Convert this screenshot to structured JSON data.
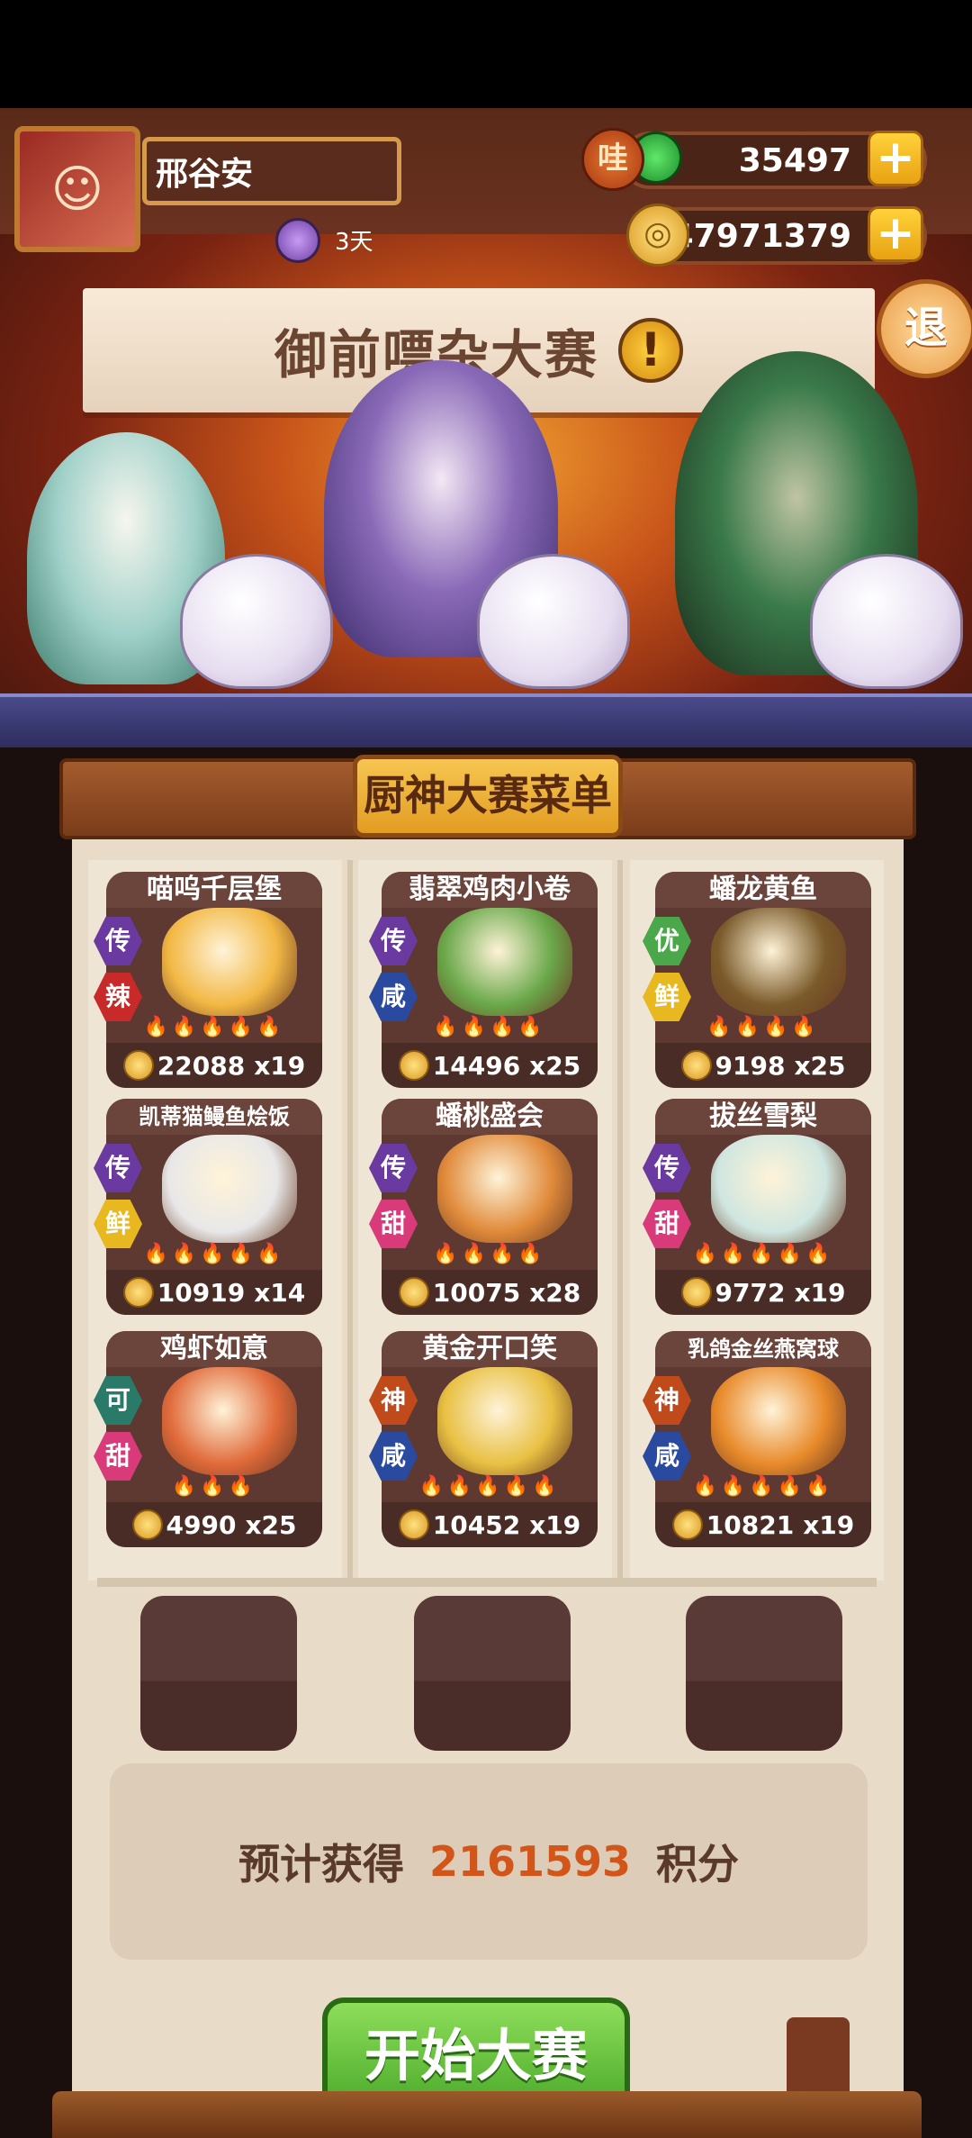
{
  "player": {
    "name": "邢谷安",
    "days": "3天"
  },
  "currencies": {
    "gem_label": "哇",
    "gems": "35497",
    "coins": "47971379",
    "plus": "+"
  },
  "exit_label": "退",
  "event_title": "御前嘌杂大赛",
  "alert_symbol": "!",
  "menu_title": "厨神大赛菜单",
  "dishes": [
    {
      "name": "喵呜千层堡",
      "rarity": "传",
      "flavor": "辣",
      "points": "22088",
      "count": "x19",
      "flames": "🔥🔥🔥🔥🔥"
    },
    {
      "name": "翡翠鸡肉小卷",
      "rarity": "传",
      "flavor": "咸",
      "points": "14496",
      "count": "x25",
      "flames": "🔥🔥🔥🔥"
    },
    {
      "name": "蟠龙黄鱼",
      "rarity": "优",
      "flavor": "鲜",
      "points": "9198",
      "count": "x25",
      "flames": "🔥🔥🔥🔥"
    },
    {
      "name": "凯蒂猫鳗鱼烩饭",
      "rarity": "传",
      "flavor": "鲜",
      "points": "10919",
      "count": "x14",
      "flames": "🔥🔥🔥🔥🔥"
    },
    {
      "name": "蟠桃盛会",
      "rarity": "传",
      "flavor": "甜",
      "points": "10075",
      "count": "x28",
      "flames": "🔥🔥🔥🔥"
    },
    {
      "name": "拔丝雪梨",
      "rarity": "传",
      "flavor": "甜",
      "points": "9772",
      "count": "x19",
      "flames": "🔥🔥🔥🔥🔥"
    },
    {
      "name": "鸡虾如意",
      "rarity": "可",
      "flavor": "甜",
      "points": "4990",
      "count": "x25",
      "flames": "🔥🔥🔥"
    },
    {
      "name": "黄金开口笑",
      "rarity": "神",
      "flavor": "咸",
      "points": "10452",
      "count": "x19",
      "flames": "🔥🔥🔥🔥🔥"
    },
    {
      "name": "乳鸽金丝燕窝球",
      "rarity": "神",
      "flavor": "咸",
      "points": "10821",
      "count": "x19",
      "flames": "🔥🔥🔥🔥🔥"
    }
  ],
  "estimate": {
    "prefix": "预计获得",
    "value": "2161593",
    "suffix": "积分"
  },
  "start_button": "开始大赛",
  "colors": {
    "accent_orange": "#d2561a",
    "start_green": "#4aa82a",
    "panel_bg": "#e8dcc8",
    "dish_card": "#5d3932"
  }
}
